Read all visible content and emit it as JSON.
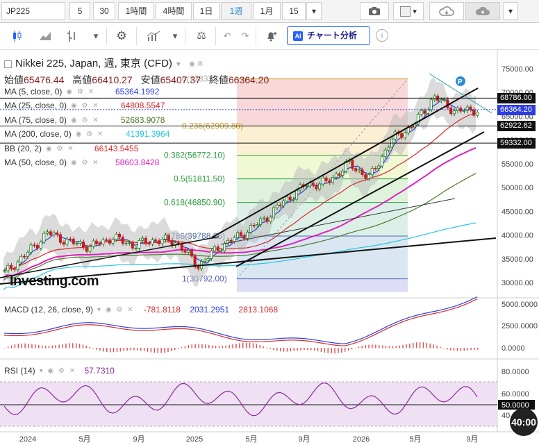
{
  "toolbar": {
    "symbol": "JP225",
    "timeframes": [
      "5",
      "30",
      "1時間",
      "4時間",
      "1日",
      "1週",
      "1月",
      "15"
    ],
    "active_timeframe": "1週",
    "ai_label": "チャート分析",
    "ai_badge": "AI"
  },
  "header": {
    "title": "Nikkei 225, Japan, 週, 東京 (CFD)",
    "ohlc": [
      {
        "label": "始値",
        "value": "65476.44"
      },
      {
        "label": "高値",
        "value": "66410.27"
      },
      {
        "label": "安値",
        "value": "65407.37"
      },
      {
        "label": "終値",
        "value": "66364.20"
      }
    ]
  },
  "indicators": [
    {
      "label": "MA (5, close, 0)",
      "value": "65364.1992",
      "color": "#2d3de0"
    },
    {
      "label": "MA (25, close, 0)",
      "value": "64808.5547",
      "color": "#d62a2a"
    },
    {
      "label": "MA (75, close, 0)",
      "value": "52683.9078",
      "color": "#4a7a2a"
    },
    {
      "label": "MA (200, close, 0)",
      "value": "41391.3964",
      "color": "#21c8e0"
    },
    {
      "label": "BB (20, 2)",
      "value": "66143.5455",
      "color": "#d62a2a"
    },
    {
      "label": "MA (50, close, 0)",
      "value": "58603.8428",
      "color": "#e020c0"
    }
  ],
  "fib_levels": [
    {
      "label": "0.236(62909.80)",
      "price": 62909.8
    },
    {
      "label": "0.382(56772.10)",
      "price": 56772.1
    },
    {
      "label": "0.5(51811.50)",
      "price": 51811.5
    },
    {
      "label": "0.618(46850.90)",
      "price": 46850.9
    },
    {
      "label": "0.786(39788.25)",
      "price": 39788.25
    },
    {
      "label": "1(30792.00)",
      "price": 30792.0
    }
  ],
  "fib_top_label": "0(72833...)",
  "price_axis": [
    "75000.00",
    "70000.00",
    "65000.00",
    "60000.00",
    "55000.00",
    "50000.00",
    "45000.00",
    "40000.00",
    "35000.00",
    "30000.00"
  ],
  "price_tags": [
    {
      "value": "68786.00",
      "color": "#111111"
    },
    {
      "value": "66364.20",
      "color": "#2d3de0"
    },
    {
      "value": "62922.62",
      "color": "#111111"
    },
    {
      "value": "59332.00",
      "color": "#111111"
    }
  ],
  "macd": {
    "label": "MACD (12, 26, close, 9)",
    "values": [
      "-781.8118",
      "2031.2951",
      "2813.1068"
    ],
    "colors": [
      "#d62a2a",
      "#2d3de0",
      "#d62a2a"
    ],
    "axis": [
      "5000.0000",
      "2500.0000",
      "0.0000"
    ]
  },
  "rsi": {
    "label": "RSI (14)",
    "value": "57.7310",
    "axis": [
      "80.0000",
      "60.0000",
      "50.0000",
      "40.0000"
    ]
  },
  "time_axis": [
    "2024",
    "5月",
    "9月",
    "2025",
    "5月",
    "9月",
    "2026",
    "5月",
    "9月"
  ],
  "logo": "Investing.com",
  "zoom_label": "40:00",
  "event_badge": "P",
  "chart_data": {
    "type": "candlestick",
    "title": "Nikkei 225, Japan, 週, 東京 (CFD)",
    "ylim": [
      28000,
      77000
    ],
    "x": [
      "2024",
      "5月",
      "9月",
      "2025",
      "5月",
      "9月",
      "2026",
      "5月",
      "9月"
    ],
    "series": [
      {
        "name": "Close (approx)",
        "values": [
          32000,
          36000,
          40500,
          38500,
          37500,
          39500,
          37800,
          39000,
          38500,
          33500,
          37500,
          40000,
          43000,
          47000,
          50500,
          51000,
          55000,
          52000,
          60000,
          63000,
          69000,
          66000,
          66364
        ]
      }
    ]
  }
}
